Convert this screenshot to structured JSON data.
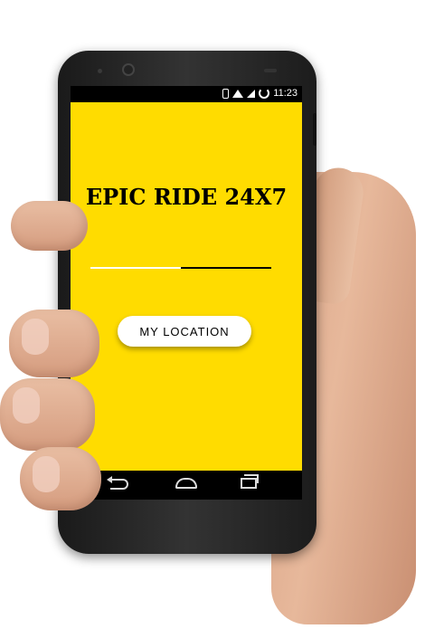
{
  "status": {
    "time": "11:23"
  },
  "app": {
    "title": "EPIC RIDE 24X7",
    "background_color": "#ffdc00",
    "progress_fraction": 0.5,
    "location_button_label": "MY LOCATION"
  },
  "icons": [
    "bluetooth-icon",
    "wifi-icon",
    "signal-icon",
    "sync-icon",
    "back-icon",
    "home-icon",
    "recent-apps-icon"
  ]
}
